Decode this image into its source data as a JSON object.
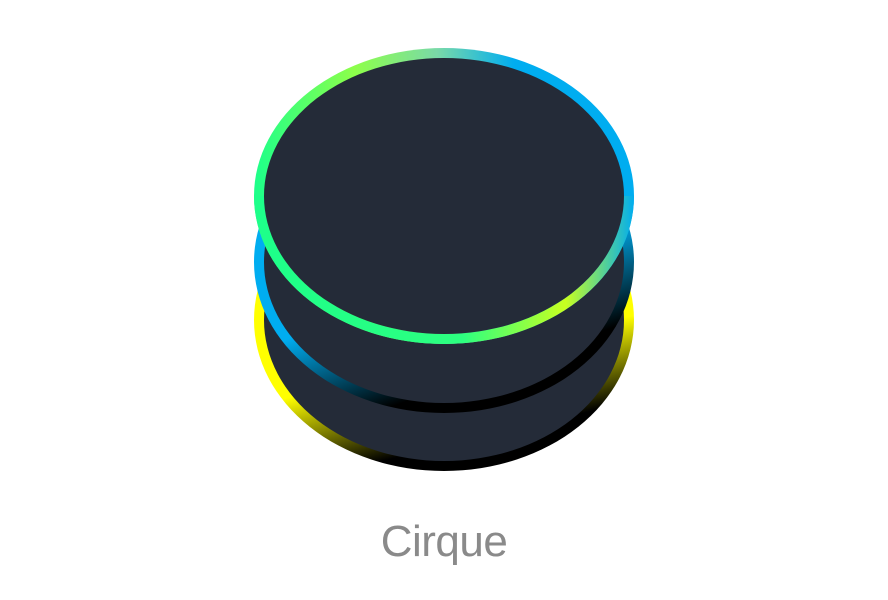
{
  "app": {
    "name": "Cirque"
  },
  "logo": {
    "icon": "stacked-discs-logo-icon",
    "disc_fill": "#242b38",
    "ring_colors": {
      "yellow": "#ffff00",
      "green": "#1dff8a",
      "blue": "#00adf0",
      "black": "#000000"
    }
  },
  "colors": {
    "background": "#ffffff",
    "label_text": "#8a8a8a"
  }
}
